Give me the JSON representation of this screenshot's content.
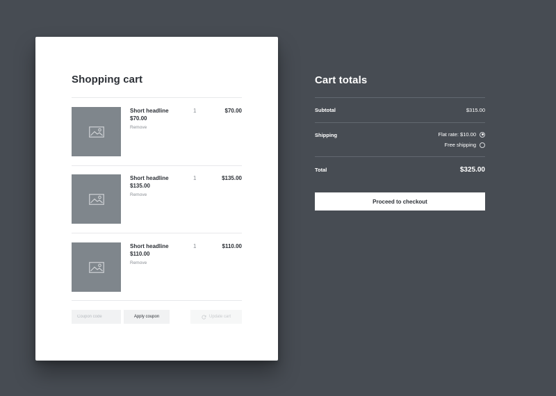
{
  "cart": {
    "title": "Shopping cart",
    "items": [
      {
        "name": "Short headline",
        "price": "$70.00",
        "remove": "Remove",
        "qty": "1",
        "total": "$70.00"
      },
      {
        "name": "Short headline",
        "price": "$135.00",
        "remove": "Remove",
        "qty": "1",
        "total": "$135.00"
      },
      {
        "name": "Short headline",
        "price": "$110.00",
        "remove": "Remove",
        "qty": "1",
        "total": "$110.00"
      }
    ],
    "coupon_placeholder": "Coupon code",
    "apply_label": "Apply coupon",
    "update_label": "Update cart"
  },
  "totals": {
    "title": "Cart totals",
    "subtotal_label": "Subtotal",
    "subtotal_value": "$315.00",
    "shipping_label": "Shipping",
    "shipping_options": [
      {
        "label": "Flat rate: $10.00",
        "selected": true
      },
      {
        "label": "Free shipping",
        "selected": false
      }
    ],
    "total_label": "Total",
    "total_value": "$325.00",
    "checkout_label": "Proceed to checkout"
  },
  "icons": {
    "product_image": "image-placeholder-icon",
    "update": "refresh-icon",
    "radio": "radio-icon"
  },
  "colors": {
    "background": "#474c53",
    "card": "#ffffff",
    "thumbnail": "#7f868c",
    "text_dark": "#2c3036"
  }
}
